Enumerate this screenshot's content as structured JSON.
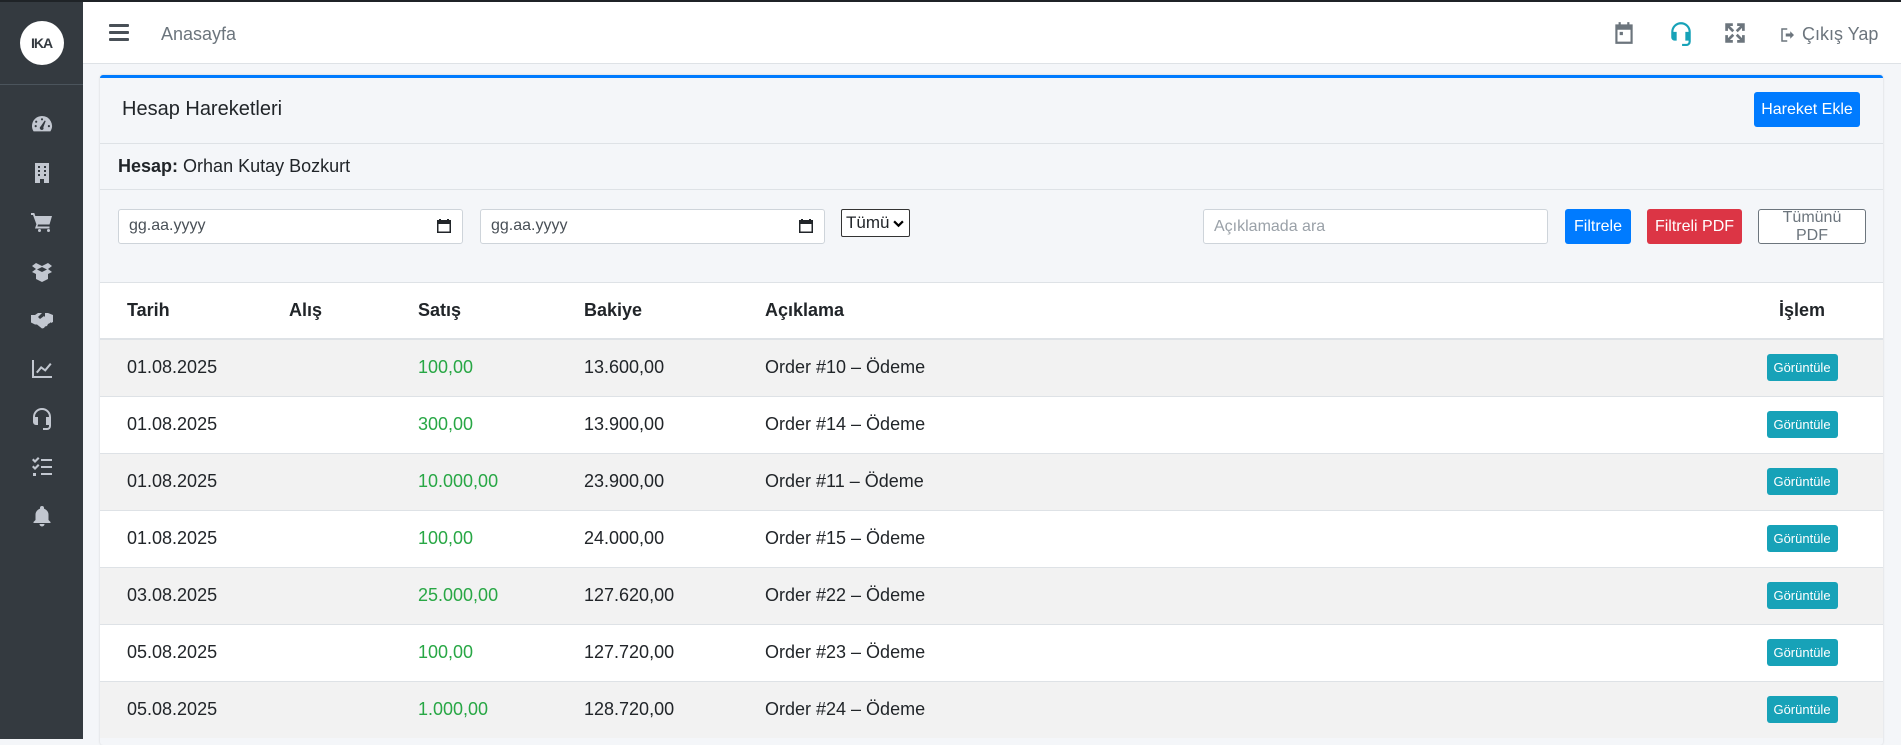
{
  "sidebar": {
    "logo_text": "IKA",
    "items": [
      {
        "icon": "dashboard-icon"
      },
      {
        "icon": "building-icon"
      },
      {
        "icon": "cart-icon"
      },
      {
        "icon": "box-open-icon"
      },
      {
        "icon": "handshake-icon"
      },
      {
        "icon": "chart-line-icon"
      },
      {
        "icon": "headset-icon"
      },
      {
        "icon": "task-list-icon"
      },
      {
        "icon": "bell-icon"
      }
    ]
  },
  "navbar": {
    "home_label": "Anasayfa",
    "logout_label": "Çıkış Yap",
    "icons": [
      "calendar-icon",
      "headset-icon",
      "expand-icon",
      "logout-icon"
    ]
  },
  "card": {
    "title": "Hesap Hareketleri",
    "add_button": "Hareket Ekle",
    "account_label": "Hesap:",
    "account_name": "Orhan Kutay Bozkurt"
  },
  "filters": {
    "start_date_placeholder": "gg.aa.yyyy",
    "end_date_placeholder": "gg.aa.yyyy",
    "type_selected": "Tümü",
    "search_placeholder": "Açıklamada ara",
    "filter_button": "Filtrele",
    "filtered_pdf_button": "Filtreli PDF",
    "all_pdf_button": "Tümünü PDF"
  },
  "table": {
    "headers": [
      "Tarih",
      "Alış",
      "Satış",
      "Bakiye",
      "Açıklama",
      "İşlem"
    ],
    "rows": [
      {
        "date": "01.08.2025",
        "alis": "",
        "satis": "100,00",
        "bakiye": "13.600,00",
        "aciklama": "Order #10 – Ödeme",
        "action": "Görüntüle"
      },
      {
        "date": "01.08.2025",
        "alis": "",
        "satis": "300,00",
        "bakiye": "13.900,00",
        "aciklama": "Order #14 – Ödeme",
        "action": "Görüntüle"
      },
      {
        "date": "01.08.2025",
        "alis": "",
        "satis": "10.000,00",
        "bakiye": "23.900,00",
        "aciklama": "Order #11 – Ödeme",
        "action": "Görüntüle"
      },
      {
        "date": "01.08.2025",
        "alis": "",
        "satis": "100,00",
        "bakiye": "24.000,00",
        "aciklama": "Order #15 – Ödeme",
        "action": "Görüntüle"
      },
      {
        "date": "03.08.2025",
        "alis": "",
        "satis": "25.000,00",
        "bakiye": "127.620,00",
        "aciklama": "Order #22 – Ödeme",
        "action": "Görüntüle"
      },
      {
        "date": "05.08.2025",
        "alis": "",
        "satis": "100,00",
        "bakiye": "127.720,00",
        "aciklama": "Order #23 – Ödeme",
        "action": "Görüntüle"
      },
      {
        "date": "05.08.2025",
        "alis": "",
        "satis": "1.000,00",
        "bakiye": "128.720,00",
        "aciklama": "Order #24 – Ödeme",
        "action": "Görüntüle"
      }
    ]
  },
  "colors": {
    "primary": "#007bff",
    "danger": "#dc3545",
    "info": "#17a2b8",
    "success": "#28a745",
    "sidebar_bg": "#343a40"
  }
}
